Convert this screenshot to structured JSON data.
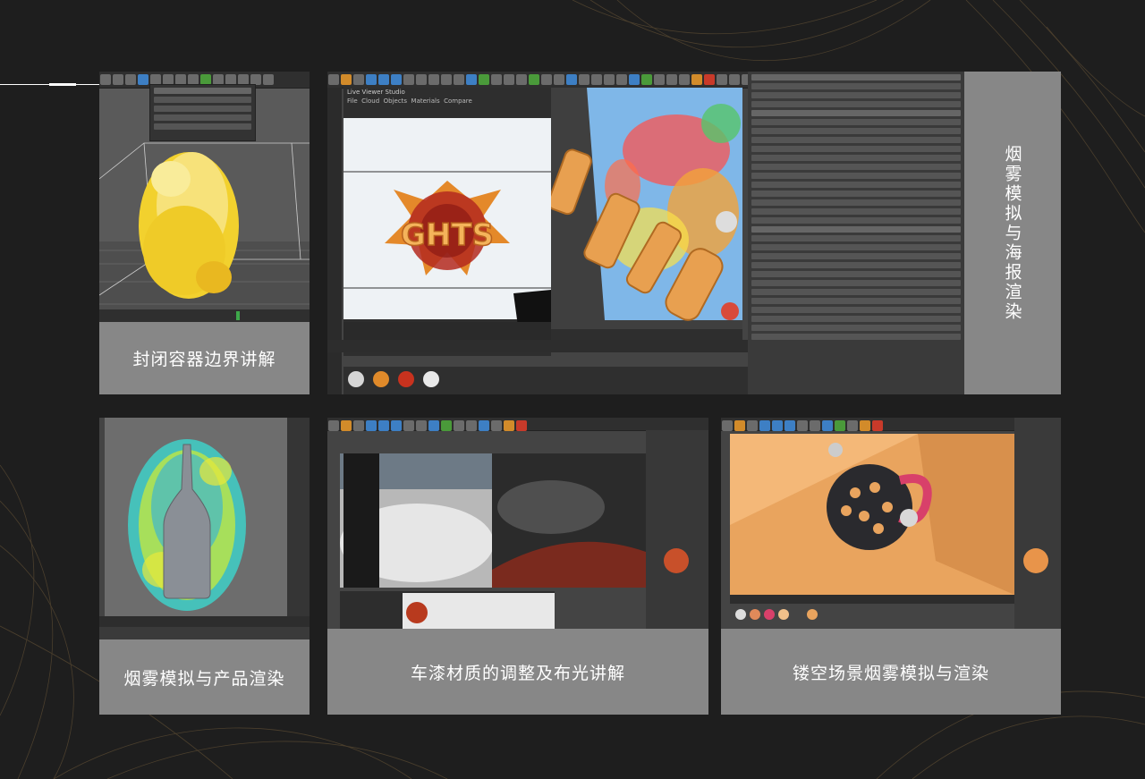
{
  "captions": {
    "tile1": "封闭容器边界讲解",
    "tile2": "烟雾模拟与海报渲染",
    "tile3": "烟雾模拟与产品渲染",
    "tile4": "车漆材质的调整及布光讲解",
    "tile5": "镂空场景烟雾模拟与渲染"
  },
  "poster_text": "GHTS",
  "viewer_menu": [
    "File",
    "Cloud",
    "Objects",
    "Materials",
    "Compare"
  ],
  "viewer_title": "Live Viewer Studio",
  "colors": {
    "background": "#1e1e1e",
    "caption_bg": "#878787",
    "ui_dark": "#3a3a3a",
    "accent_blue": "#3d7fc4",
    "accent_orange": "#d28b2a"
  }
}
